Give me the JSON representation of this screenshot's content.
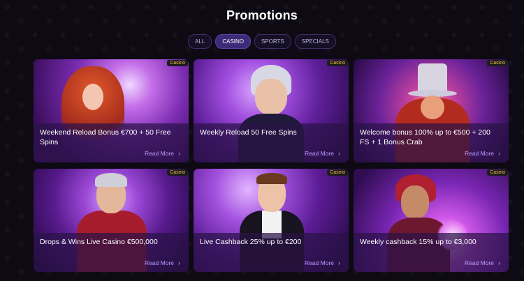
{
  "page": {
    "title": "Promotions"
  },
  "filters": [
    {
      "label": "ALL",
      "active": false
    },
    {
      "label": "CASINO",
      "active": true
    },
    {
      "label": "SPORTS",
      "active": false
    },
    {
      "label": "SPECIALS",
      "active": false
    }
  ],
  "promotions": [
    {
      "badge": "Casino",
      "title": "Weekend Reload Bonus €700 + 50 Free Spins",
      "link": "Read More"
    },
    {
      "badge": "Casino",
      "title": "Weekly Reload 50 Free Spins",
      "link": "Read More"
    },
    {
      "badge": "Casino",
      "title": "Welcome bonus 100% up to €500 + 200 FS + 1 Bonus Crab",
      "link": "Read More"
    },
    {
      "badge": "Casino",
      "title": "Drops & Wins Live Casino €500,000",
      "link": "Read More"
    },
    {
      "badge": "Casino",
      "title": "Live Cashback 25% up to €200",
      "link": "Read More"
    },
    {
      "badge": "Casino",
      "title": "Weekly cashback 15% up to €3,000",
      "link": "Read More"
    }
  ],
  "colors": {
    "accent": "#b89cff",
    "badge_text": "#f2c14e",
    "active_pill": "#3d2a78"
  },
  "icons": {
    "read_more": "chevron-right-icon"
  }
}
